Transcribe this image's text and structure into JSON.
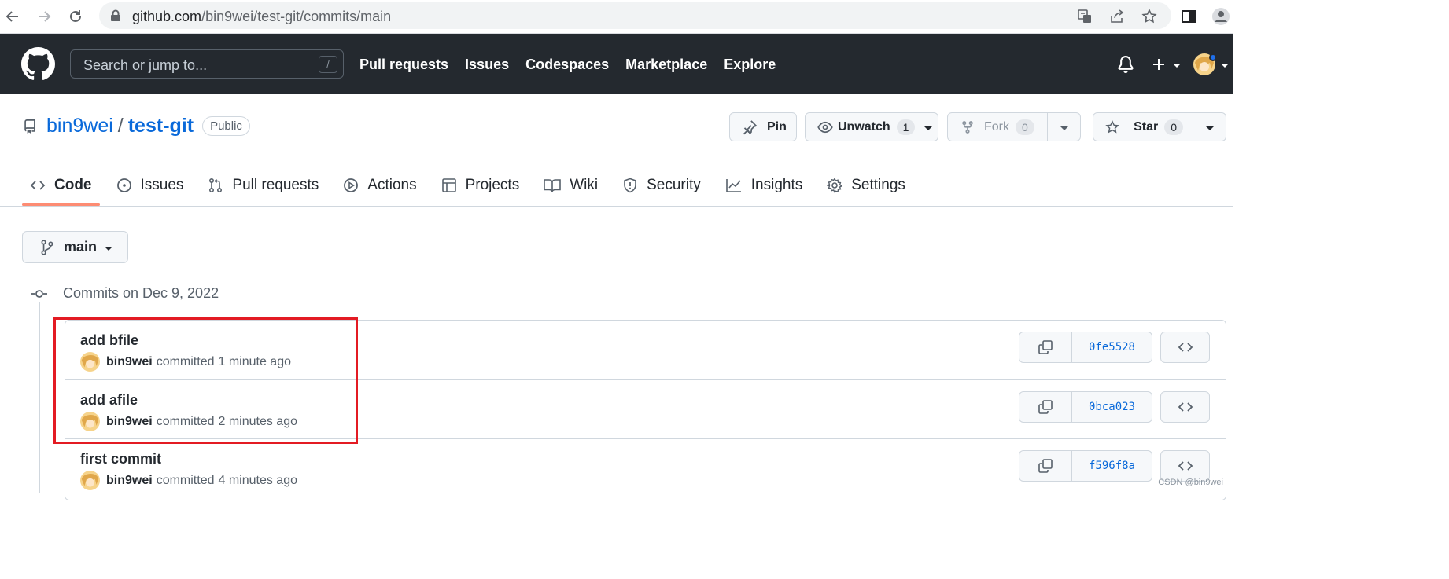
{
  "browser": {
    "url_host": "github.com",
    "url_path": "/bin9wei/test-git/commits/main"
  },
  "header": {
    "search_placeholder": "Search or jump to...",
    "search_shortcut": "/",
    "nav": [
      "Pull requests",
      "Issues",
      "Codespaces",
      "Marketplace",
      "Explore"
    ]
  },
  "repo": {
    "owner": "bin9wei",
    "separator": "/",
    "name": "test-git",
    "visibility": "Public",
    "pin_label": "Pin",
    "watch_label": "Unwatch",
    "watch_count": "1",
    "fork_label": "Fork",
    "fork_count": "0",
    "star_label": "Star",
    "star_count": "0"
  },
  "tabs": [
    {
      "label": "Code",
      "icon": "code-icon",
      "selected": true
    },
    {
      "label": "Issues",
      "icon": "issue-icon"
    },
    {
      "label": "Pull requests",
      "icon": "pull-request-icon"
    },
    {
      "label": "Actions",
      "icon": "play-icon"
    },
    {
      "label": "Projects",
      "icon": "table-icon"
    },
    {
      "label": "Wiki",
      "icon": "book-icon"
    },
    {
      "label": "Security",
      "icon": "shield-icon"
    },
    {
      "label": "Insights",
      "icon": "graph-icon"
    },
    {
      "label": "Settings",
      "icon": "gear-icon"
    }
  ],
  "branch": {
    "name": "main"
  },
  "commits_group": {
    "date_label": "Commits on Dec 9, 2022",
    "commits": [
      {
        "message": "add bfile",
        "author": "bin9wei",
        "verb": "committed",
        "time": "1 minute ago",
        "sha": "0fe5528"
      },
      {
        "message": "add afile",
        "author": "bin9wei",
        "verb": "committed",
        "time": "2 minutes ago",
        "sha": "0bca023"
      },
      {
        "message": "first commit",
        "author": "bin9wei",
        "verb": "committed",
        "time": "4 minutes ago",
        "sha": "f596f8a"
      }
    ]
  },
  "watermark": "CSDN @bin9wei",
  "colors": {
    "header_bg": "#24292f",
    "link": "#0969da",
    "tab_underline": "#fd8c73",
    "highlight": "#e31b23"
  }
}
